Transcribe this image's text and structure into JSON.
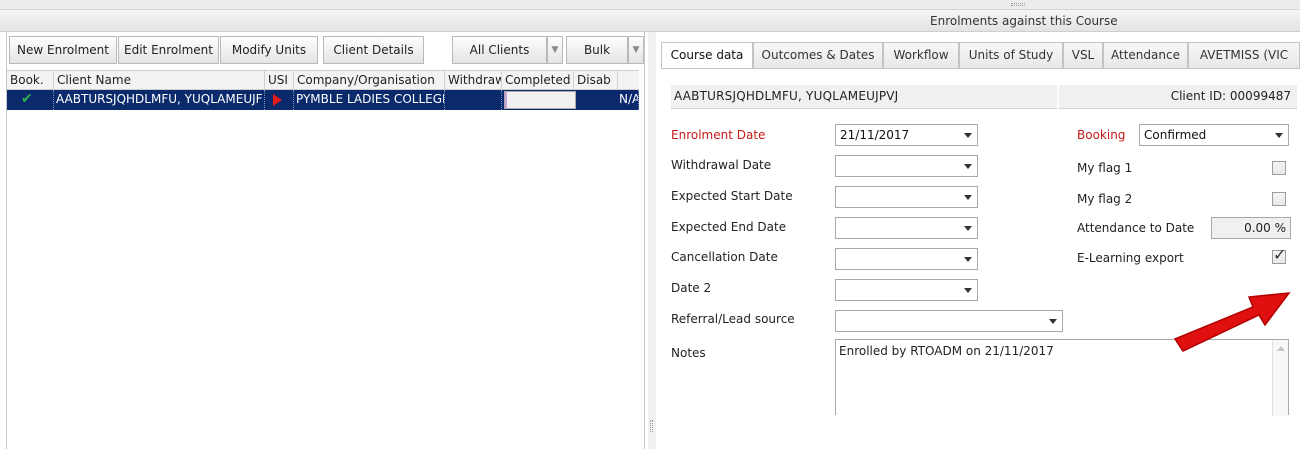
{
  "header": {
    "title": "Enrolments against this Course"
  },
  "left_toolbar": {
    "new_enrolment": "New Enrolment",
    "edit_enrolment": "Edit Enrolment",
    "modify_units": "Modify Units",
    "client_details": "Client Details",
    "filter": "All Clients",
    "bulk": "Bulk"
  },
  "grid": {
    "columns": [
      "Book.",
      "Client Name",
      "USI",
      "Company/Organisation",
      "Withdraw",
      "Completed",
      "Disab"
    ],
    "rows": [
      {
        "book": "✔",
        "client_name": "AABTURSJQHDLMFU, YUQLAMEUJF",
        "usi": "",
        "company": "PYMBLE LADIES COLLEGE",
        "withdrawn": "",
        "completed": "",
        "disab": "N/A"
      }
    ]
  },
  "tabs": [
    "Course data",
    "Outcomes & Dates",
    "Workflow",
    "Units of Study",
    "VSL",
    "Attendance",
    "AVETMISS (VIC"
  ],
  "course_data": {
    "client_name": "AABTURSJQHDLMFU, YUQLAMEUJPVJ",
    "client_id": "Client ID:  00099487",
    "enrolment_date_label": "Enrolment Date",
    "enrolment_date": "21/11/2017",
    "withdrawal_date_label": "Withdrawal  Date",
    "expected_start_label": "Expected Start Date",
    "expected_end_label": "Expected End Date",
    "cancellation_label": "Cancellation Date",
    "date2_label": "Date 2",
    "referral_label": "Referral/Lead source",
    "notes_label": "Notes",
    "notes": "Enrolled by RTOADM on 21/11/2017",
    "booking_label": "Booking",
    "booking": "Confirmed",
    "my_flag1_label": "My flag 1",
    "my_flag2_label": "My flag 2",
    "attendance_label": "Attendance to Date",
    "attendance": "0.00 %",
    "elearning_label": "E-Learning export",
    "elearning_checked": true
  },
  "colors": {
    "selected_row": "#0a2a6b",
    "required_label": "#c41a1a",
    "annotation_arrow": "#e01010"
  }
}
